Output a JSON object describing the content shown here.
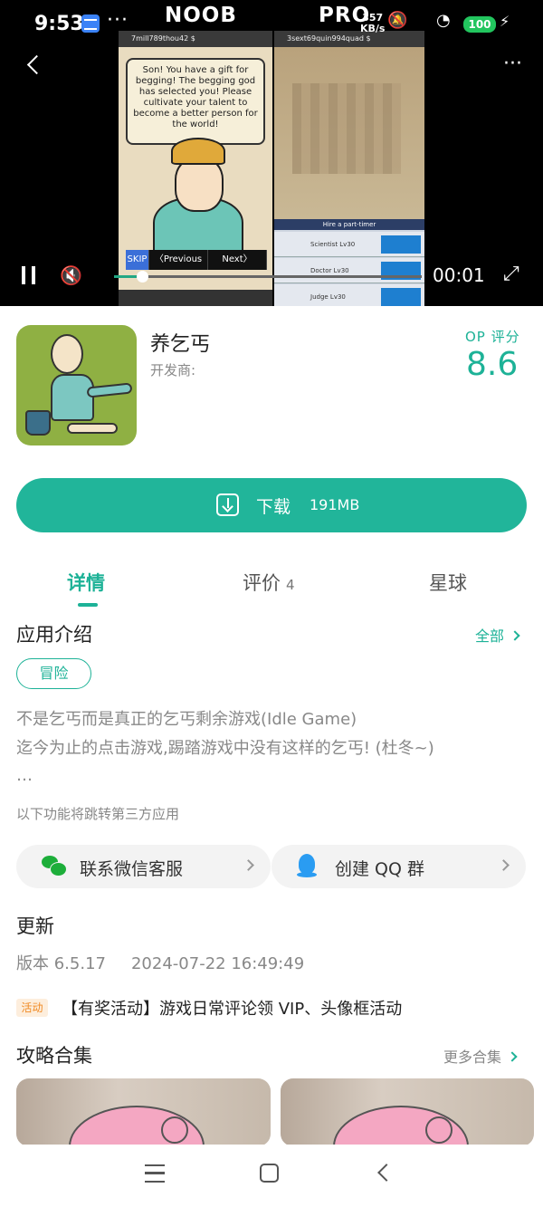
{
  "status_bar": {
    "time": "9:53",
    "dots": "···",
    "speed_value": "357",
    "speed_unit": "KB/s",
    "battery": "100"
  },
  "video": {
    "watermark_left": "NOOB",
    "watermark_right": "PRO",
    "current_time": "00:01",
    "progress_fraction": 0.09,
    "game_left": {
      "top_bar": "7mill789thou42 $",
      "bubble_text": "Son! You have a gift for begging! The begging god has selected you! Please cultivate your talent to become a better person for the world!",
      "controls": [
        "SKIP",
        "〈Previous",
        "Next〉"
      ]
    },
    "game_right": {
      "top_bar": "3sext69quin994quad $",
      "hire_bar": "Hire a part-timer",
      "rows": [
        "Scientist Lv30",
        "Doctor Lv30",
        "Judge Lv30"
      ]
    }
  },
  "app": {
    "name": "养乞丐",
    "developer_label": "开发商:",
    "score_label": "OP 评分",
    "score": "8.6"
  },
  "download": {
    "label": "下载",
    "size": "191MB"
  },
  "tabs": {
    "details": "详情",
    "reviews": "评价",
    "reviews_count": "4",
    "planet": "星球"
  },
  "intro": {
    "title": "应用介绍",
    "view_all": "全部",
    "tag": "冒险",
    "line1": "不是乞丐而是真正的乞丐剩余游戏(Idle Game)",
    "line2": "迄今为止的点击游戏,踢踏游戏中没有这样的乞丐! (杜冬~)",
    "ellipsis": "…",
    "third_party_note": "以下功能将跳转第三方应用",
    "wechat_label": "联系微信客服",
    "qq_label": "创建 QQ 群"
  },
  "update": {
    "title": "更新",
    "version": "版本 6.5.17",
    "date": "2024-07-22 16:49:49",
    "activity_badge": "活动",
    "activity_text": "【有奖活动】游戏日常评论领 VIP、头像框活动"
  },
  "guides": {
    "title": "攻略合集",
    "more": "更多合集"
  },
  "colors": {
    "accent": "#1db297",
    "download_bg": "#21b59a",
    "activity_orange": "#f08a24"
  }
}
